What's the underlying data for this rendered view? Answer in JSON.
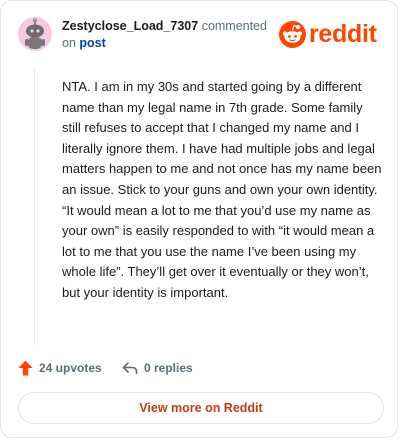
{
  "header": {
    "username": "Zestyclose_Load_7307",
    "action_text": "commented",
    "on_text": "on",
    "post_link": "post",
    "brand_name": "reddit"
  },
  "comment": {
    "body": "NTA. I am in my 30s and started going by a different name than my legal name in 7th grade. Some family still refuses to accept that I changed my name and I literally ignore them. I have had multiple jobs and legal matters happen to me and not once has my name been an issue. Stick to your guns and own your own identity. “It would mean a lot to me that you’d use my name as your own” is easily responded to with “it would mean a lot to me that you use the name I’ve been using my whole life”. They’ll get over it eventually or they won’t, but your identity is important."
  },
  "actions": {
    "upvotes": "24 upvotes",
    "replies": "0 replies"
  },
  "footer": {
    "view_more_label": "View more on Reddit"
  },
  "colors": {
    "brand": "#ff4500",
    "link": "#0045ac",
    "cta": "#c43c12",
    "muted": "#576f76"
  },
  "icons": {
    "avatar": "snoo-avatar",
    "brand": "reddit-snoo-icon",
    "upvote": "upvote-arrow-icon",
    "reply": "reply-arrow-icon"
  }
}
